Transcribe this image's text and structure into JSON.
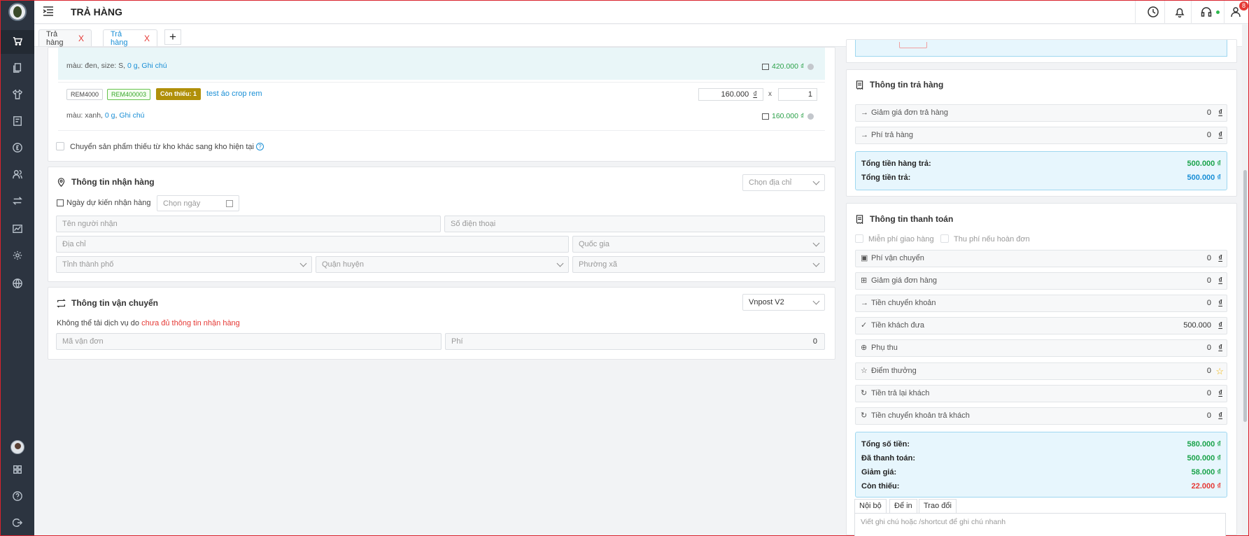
{
  "header": {
    "title": "TRẢ HÀNG",
    "notification_count": "8"
  },
  "tabs": [
    {
      "label": "Trả hàng",
      "close": "X"
    },
    {
      "label": "Trả hàng",
      "close": "X"
    }
  ],
  "tab_add": "+",
  "items": [
    {
      "meta_prefix": "màu: đen, size: S, ",
      "weight": "0 g",
      "note": "Ghi chú",
      "total": "420.000 ₫"
    },
    {
      "code": "REM4000",
      "sku": "REM400003",
      "badge": "Còn thiếu: 1",
      "name": "test áo crop rem",
      "price": "160.000",
      "currency": "₫",
      "times": "x",
      "qty": "1",
      "meta_prefix": "màu: xanh, ",
      "weight": "0 g",
      "note": "Ghi chú",
      "total": "160.000 ₫"
    }
  ],
  "transfer_checkbox": "Chuyển sản phẩm thiếu từ kho khác sang kho hiện tại",
  "help_glyph": "?",
  "receiving": {
    "title": "Thông tin nhận hàng",
    "choose_address": "Chọn địa chỉ",
    "expected_date_label": "Ngày dự kiến nhận hàng",
    "date_placeholder": "Chọn ngày",
    "receiver_placeholder": "Tên người nhận",
    "phone_placeholder": "Số điện thoại",
    "address_placeholder": "Địa chỉ",
    "country_placeholder": "Quốc gia",
    "province_placeholder": "Tỉnh thành phố",
    "district_placeholder": "Quận huyện",
    "ward_placeholder": "Phường xã"
  },
  "shipping": {
    "title": "Thông tin vận chuyển",
    "carrier": "Vnpost V2",
    "error_prefix": "Không thể tải dịch vụ do ",
    "error_highlight": "chưa đủ thông tin nhận hàng",
    "tracking_placeholder": "Mã vận đơn",
    "fee_label": "Phí",
    "fee_value": "0"
  },
  "return_info": {
    "title": "Thông tin trả hàng",
    "rows": [
      {
        "label": "Giảm giá đơn trả hàng",
        "value": "0",
        "currency": "₫"
      },
      {
        "label": "Phí trả hàng",
        "value": "0",
        "currency": "₫"
      }
    ],
    "summary": [
      {
        "label": "Tổng tiền hàng trả:",
        "value": "500.000 ₫"
      },
      {
        "label": "Tổng tiền trả:",
        "value": "500.000 ₫"
      }
    ]
  },
  "payment": {
    "title": "Thông tin thanh toán",
    "free_shipping": "Miễn phí giao hàng",
    "charge_if_cancel": "Thu phí nếu hoàn đơn",
    "rows": [
      {
        "label": "Phí vận chuyển",
        "value": "0",
        "currency": "₫"
      },
      {
        "label": "Giảm giá đơn hàng",
        "value": "0",
        "currency": "₫"
      },
      {
        "label": "Tiền chuyển khoản",
        "value": "0",
        "currency": "₫"
      },
      {
        "label": "Tiền khách đưa",
        "value": "500.000",
        "currency": "₫"
      },
      {
        "label": "Phụ thu",
        "value": "0",
        "currency": "₫"
      },
      {
        "label": "Điểm thưởng",
        "value": "0",
        "currency": "☆"
      },
      {
        "label": "Tiền trả lại khách",
        "value": "0",
        "currency": "₫"
      },
      {
        "label": "Tiền chuyển khoản trả khách",
        "value": "0",
        "currency": "₫"
      }
    ],
    "summary": [
      {
        "label": "Tổng số tiền:",
        "value": "580.000 ₫"
      },
      {
        "label": "Đã thanh toán:",
        "value": "500.000 ₫"
      },
      {
        "label": "Giảm giá:",
        "value": "58.000 ₫"
      },
      {
        "label": "Còn thiếu:",
        "value": "22.000 ₫"
      }
    ]
  },
  "notes": {
    "tabs": [
      "Nội bộ",
      "Để in",
      "Trao đổi"
    ],
    "placeholder": "Viết ghi chú hoặc /shortcut để ghi chú nhanh"
  },
  "colors": {
    "accent": "#1a8fd6",
    "success": "#1aa34a",
    "danger": "#e53935",
    "sidebar": "#2c3440"
  }
}
